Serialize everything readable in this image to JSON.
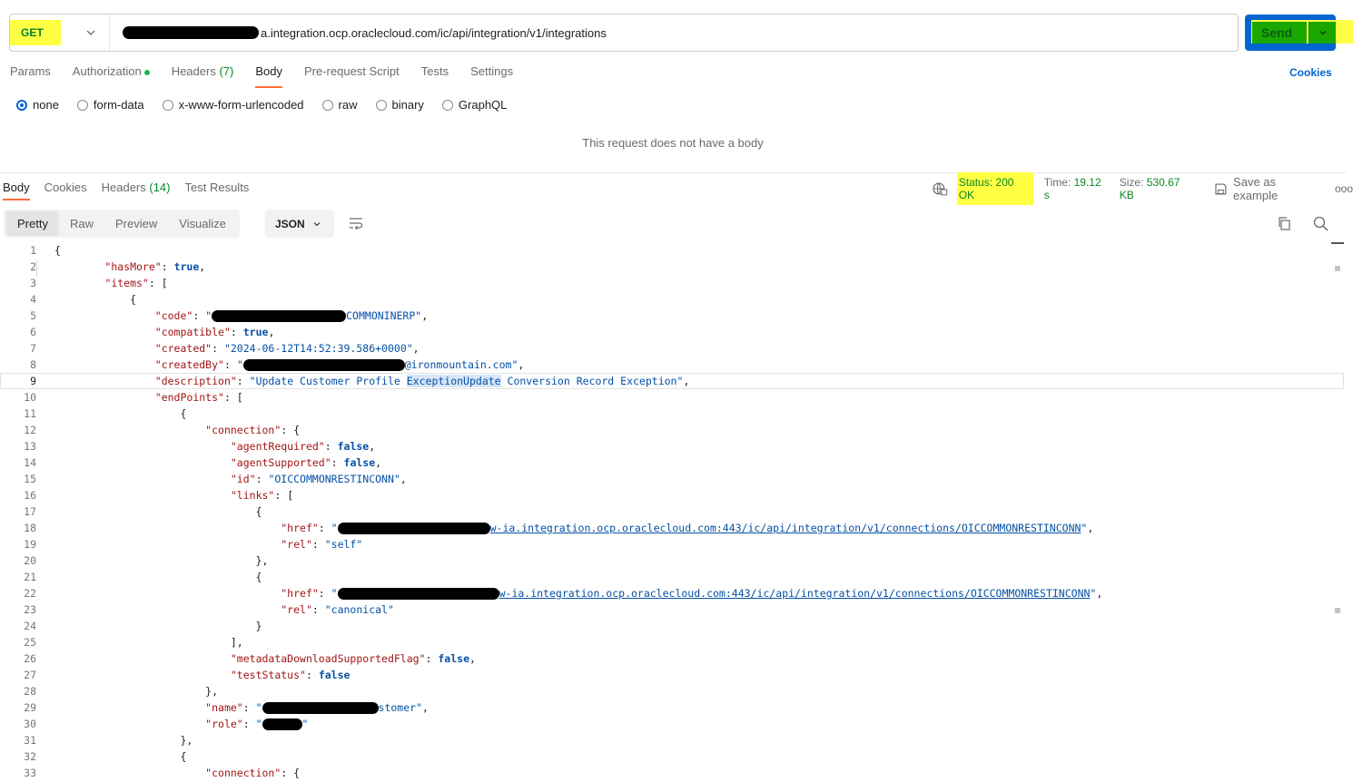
{
  "request": {
    "method": "GET",
    "url_suffix": "a.integration.ocp.oraclecloud.com/ic/api/integration/v1/integrations",
    "send_label": "Send"
  },
  "request_tabs": [
    {
      "label": "Params",
      "count": ""
    },
    {
      "label": "Authorization",
      "count": ""
    },
    {
      "label": "Headers",
      "count": "(7)"
    },
    {
      "label": "Body",
      "count": ""
    },
    {
      "label": "Pre-request Script",
      "count": ""
    },
    {
      "label": "Tests",
      "count": ""
    },
    {
      "label": "Settings",
      "count": ""
    }
  ],
  "cookies_label": "Cookies",
  "body_types": [
    "none",
    "form-data",
    "x-www-form-urlencoded",
    "raw",
    "binary",
    "GraphQL"
  ],
  "selected_body_type": "none",
  "no_body_message": "This request does not have a body",
  "response_tabs": [
    {
      "label": "Body",
      "count": ""
    },
    {
      "label": "Cookies",
      "count": ""
    },
    {
      "label": "Headers",
      "count": "(14)"
    },
    {
      "label": "Test Results",
      "count": ""
    }
  ],
  "response_meta": {
    "status_label": "Status:",
    "status_value": "200 OK",
    "time_label": "Time:",
    "time_value": "19.12 s",
    "size_label": "Size:",
    "size_value": "530.67 KB",
    "save_example": "Save as example",
    "more": "ooo"
  },
  "view_modes": [
    "Pretty",
    "Raw",
    "Preview",
    "Visualize"
  ],
  "format": "JSON",
  "code_lines": [
    "{",
    "\"hasMore\": true,",
    "\"items\": [",
    "{",
    "\"code\": \"...COMMONINERP\",",
    "\"compatible\": true,",
    "\"created\": \"2024-06-12T14:52:39.586+0000\",",
    "\"createdBy\": \"...@ironmountain.com\",",
    "\"description\": \"Update Customer Profile ExceptionUpdate Conversion Record Exception\",",
    "\"endPoints\": [",
    "{",
    "\"connection\": {",
    "\"agentRequired\": false,",
    "\"agentSupported\": false,",
    "\"id\": \"OICCOMMONRESTINCONN\",",
    "\"links\": [",
    "{",
    "\"href\": \"...w-ia.integration.ocp.oraclecloud.com:443/ic/api/integration/v1/connections/OICCOMMONRESTINCONN\",",
    "\"rel\": \"self\"",
    "},",
    "{",
    "\"href\": \"...w-ia.integration.ocp.oraclecloud.com:443/ic/api/integration/v1/connections/OICCOMMONRESTINCONN\",",
    "\"rel\": \"canonical\"",
    "}",
    "],",
    "\"metadataDownloadSupportedFlag\": false,",
    "\"testStatus\": false",
    "},",
    "\"name\": \"...stomer\",",
    "\"role\": \"...\"",
    "},",
    "{",
    "\"connection\": {"
  ]
}
